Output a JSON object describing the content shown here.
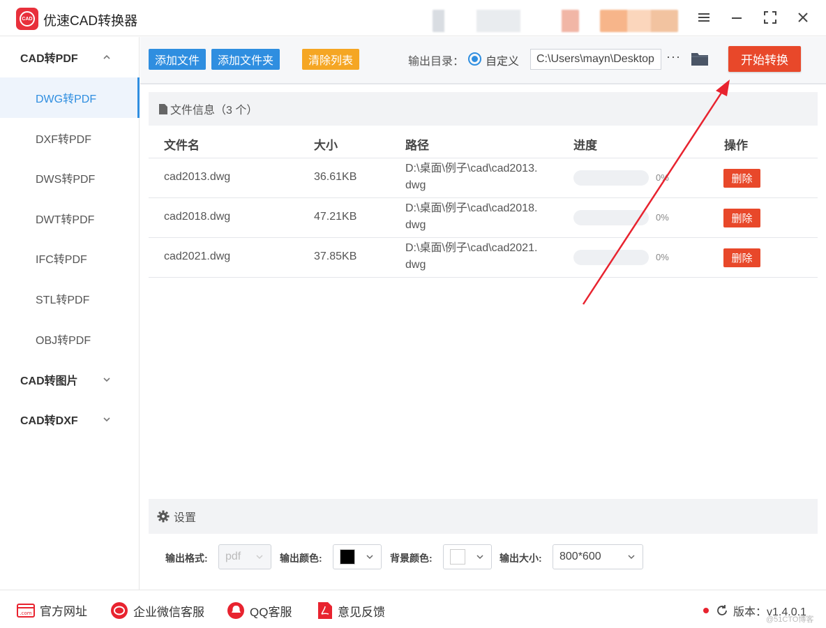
{
  "app": {
    "title": "优速CAD转换器",
    "logo_text": "CAD"
  },
  "sidebar": {
    "groups": [
      {
        "label": "CAD转PDF",
        "expanded": true,
        "items": [
          "DWG转PDF",
          "DXF转PDF",
          "DWS转PDF",
          "DWT转PDF",
          "IFC转PDF",
          "STL转PDF",
          "OBJ转PDF"
        ],
        "active": "DWG转PDF"
      },
      {
        "label": "CAD转图片",
        "expanded": false
      },
      {
        "label": "CAD转DXF",
        "expanded": false
      }
    ]
  },
  "toolbar": {
    "add_file": "添加文件",
    "add_folder": "添加文件夹",
    "clear_list": "清除列表",
    "output_dir_label": "输出目录：",
    "custom_option": "自定义",
    "output_path": "C:\\Users\\mayn\\Desktop",
    "more": "···",
    "start": "开始转换"
  },
  "file_panel": {
    "title": "文件信息（3 个）",
    "columns": [
      "文件名",
      "大小",
      "路径",
      "进度",
      "操作"
    ],
    "rows": [
      {
        "name": "cad2013.dwg",
        "size": "36.61KB",
        "path_line1": "D:\\桌面\\例子\\cad\\cad2013.",
        "path_line2": "dwg",
        "progress_text": "0%",
        "progress": 0,
        "action": "删除"
      },
      {
        "name": "cad2018.dwg",
        "size": "47.21KB",
        "path_line1": "D:\\桌面\\例子\\cad\\cad2018.",
        "path_line2": "dwg",
        "progress_text": "0%",
        "progress": 0,
        "action": "删除"
      },
      {
        "name": "cad2021.dwg",
        "size": "37.85KB",
        "path_line1": "D:\\桌面\\例子\\cad\\cad2021.",
        "path_line2": "dwg",
        "progress_text": "0%",
        "progress": 0,
        "action": "删除"
      }
    ]
  },
  "settings": {
    "title": "设置",
    "format_label": "输出格式:",
    "format_value": "pdf",
    "color_label": "输出颜色:",
    "color_value": "#000000",
    "bg_label": "背景颜色:",
    "bg_value": "#ffffff",
    "size_label": "输出大小:",
    "size_value": "800*600"
  },
  "footer": {
    "website": "官方网址",
    "wechat": "企业微信客服",
    "qq": "QQ客服",
    "feedback": "意见反馈",
    "version": "版本：v1.4.0.1",
    "watermark": "@51CTO博客"
  },
  "colors": {
    "accent": "#2f8ee0",
    "danger": "#e8482a",
    "warning": "#f5a623",
    "logo": "#e8303b"
  }
}
